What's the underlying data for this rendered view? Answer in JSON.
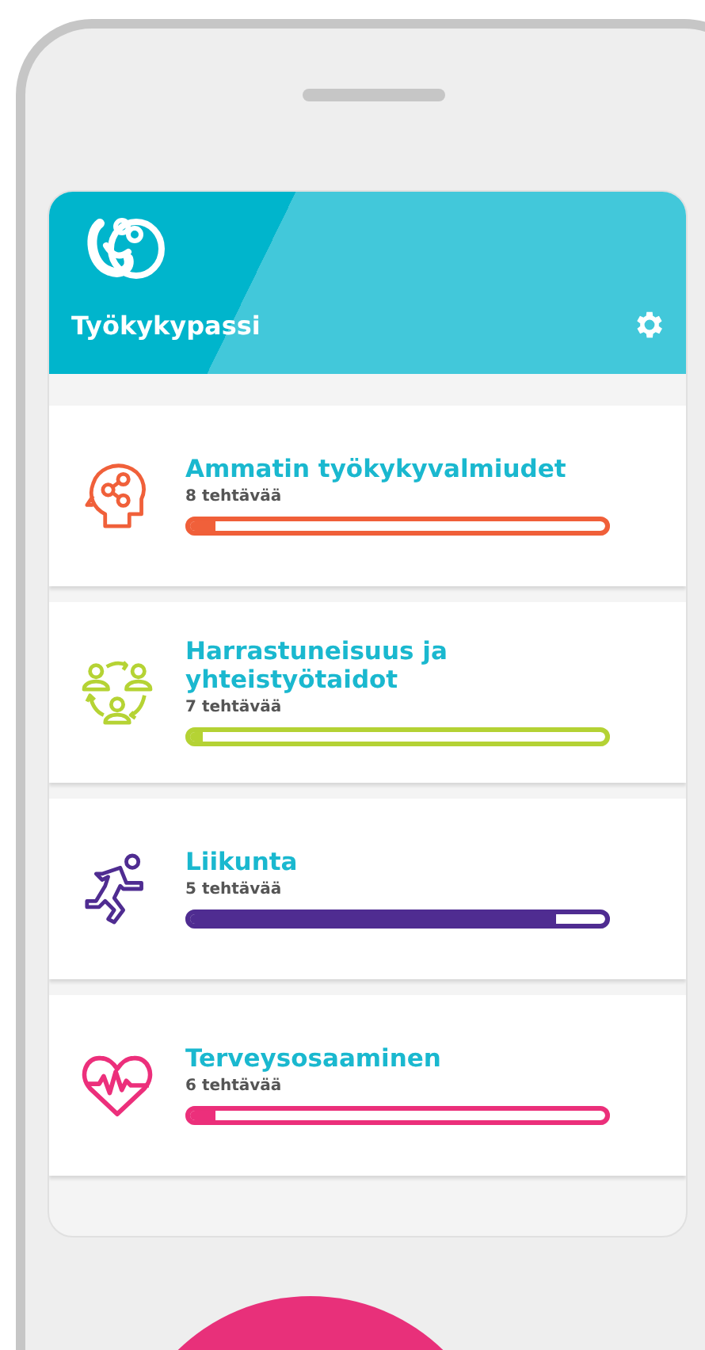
{
  "app": {
    "title": "Työkykypassi"
  },
  "categories": [
    {
      "kind": "head",
      "title": "Ammatin työkykyvalmiudet",
      "tasks": "8 tehtävää",
      "level": 0.06,
      "color": "#f0603a"
    },
    {
      "kind": "people",
      "title": "Harrastuneisuus ja yhteistyötaidot",
      "tasks": "7 tehtävää",
      "level": 0.02,
      "color": "#b5d334"
    },
    {
      "kind": "runner",
      "title": "Liikunta",
      "tasks": "5 tehtävää",
      "level": 0.88,
      "color": "#4f2c91"
    },
    {
      "kind": "heart",
      "title": "Terveysosaaminen",
      "tasks": "6 tehtävää",
      "level": 0.06,
      "color": "#ec2f7b"
    }
  ]
}
